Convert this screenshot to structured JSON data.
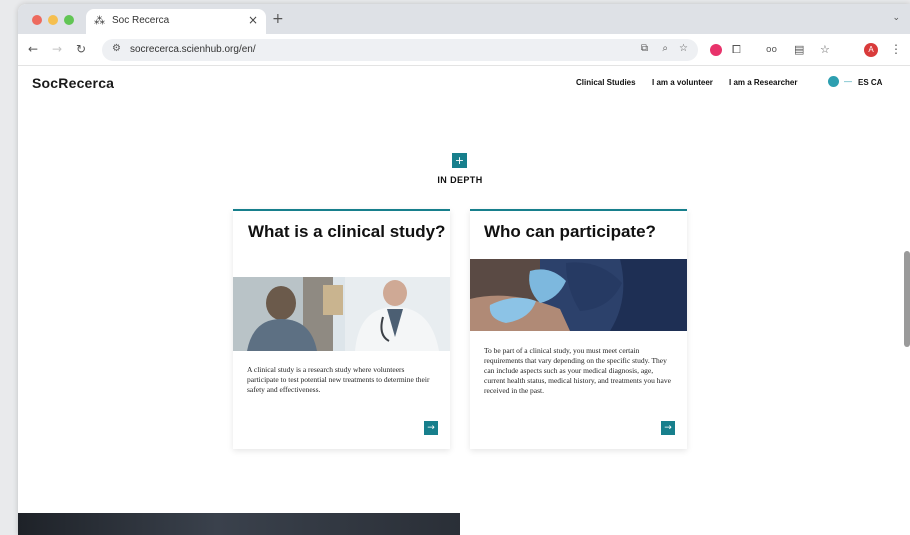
{
  "browser": {
    "tab_title": "Soc Recerca",
    "tab_favicon": "⁂",
    "tab_close": "×",
    "new_tab": "+",
    "tab_menu": "⌄",
    "url": "socrecerca.scienhub.org/en/",
    "avatar_letter": "A"
  },
  "site": {
    "logo": "SocRecerca",
    "nav": [
      {
        "label": "Clinical Studies"
      },
      {
        "label": "I am a volunteer"
      },
      {
        "label": "I am a Researcher"
      }
    ],
    "languages": "ES CA",
    "accent_color": "#177f8c"
  },
  "section": {
    "badge": "+",
    "label": "IN DEPTH"
  },
  "cards": [
    {
      "title": "What is a clinical study?",
      "image": "doctor-with-patient",
      "text": "A clinical study is a research study where volunteers participate to test potential new treatments to determine their safety and effectiveness.",
      "arrow": "→"
    },
    {
      "title": "Who can participate?",
      "image": "vaccination-gloved-hands",
      "text": "To be part of a clinical study, you must meet certain requirements that vary depending on the specific study. They can include aspects such as your medical diagnosis, age, current health status, medical history, and treatments you have received in the past.",
      "arrow": "→"
    }
  ]
}
